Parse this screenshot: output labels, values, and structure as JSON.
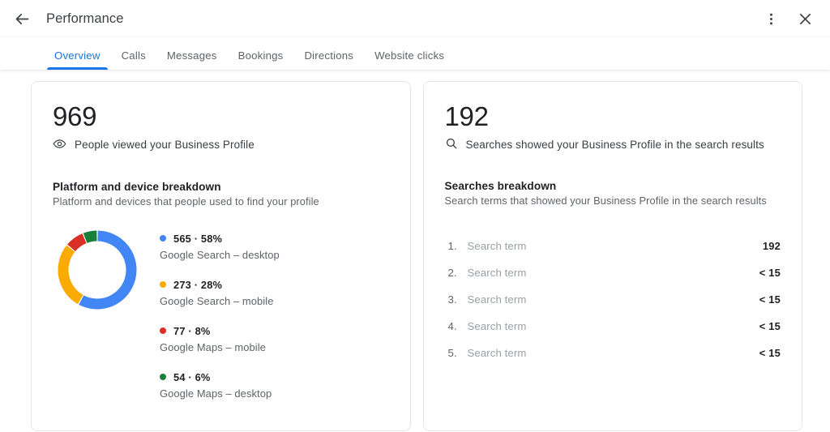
{
  "header": {
    "title": "Performance",
    "back_icon": "arrow-back-icon",
    "more_icon": "more-vert-icon",
    "close_icon": "close-icon"
  },
  "tabs": [
    {
      "label": "Overview",
      "active": true
    },
    {
      "label": "Calls",
      "active": false
    },
    {
      "label": "Messages",
      "active": false
    },
    {
      "label": "Bookings",
      "active": false
    },
    {
      "label": "Directions",
      "active": false
    },
    {
      "label": "Website clicks",
      "active": false
    }
  ],
  "colors": {
    "accent": "#1a73e8",
    "blue": "#4285f4",
    "yellow": "#f9ab00",
    "red": "#d93025",
    "green": "#188038",
    "text_primary": "#202124",
    "text_secondary": "#5f6368",
    "text_muted": "#9aa0a6"
  },
  "left_card": {
    "value": "969",
    "metric_label": "People viewed your Business Profile",
    "metric_icon": "eye-icon",
    "section_title": "Platform and device breakdown",
    "section_desc": "Platform and devices that people used to find your profile"
  },
  "right_card": {
    "value": "192",
    "metric_label": "Searches showed your Business Profile in the search results",
    "metric_icon": "search-icon",
    "section_title": "Searches breakdown",
    "section_desc": "Search terms that showed your Business Profile in the search results",
    "terms": [
      {
        "rank": "1.",
        "name": "Search term",
        "count": "192"
      },
      {
        "rank": "2.",
        "name": "Search term",
        "count": "< 15"
      },
      {
        "rank": "3.",
        "name": "Search term",
        "count": "< 15"
      },
      {
        "rank": "4.",
        "name": "Search term",
        "count": "< 15"
      },
      {
        "rank": "5.",
        "name": "Search term",
        "count": "< 15"
      }
    ]
  },
  "chart_data": {
    "type": "pie",
    "title": "Platform and device breakdown",
    "subtitle": "Platform and devices that people used to find your profile",
    "total": 969,
    "legend_position": "right",
    "categories": [
      "Google Search – desktop",
      "Google Search – mobile",
      "Google Maps – mobile",
      "Google Maps – desktop"
    ],
    "values": [
      565,
      273,
      77,
      54
    ],
    "percents": [
      58,
      28,
      8,
      6
    ],
    "colors": [
      "#4285f4",
      "#f9ab00",
      "#d93025",
      "#188038"
    ],
    "value_labels": [
      "565 · 58%",
      "273 · 28%",
      "77 · 8%",
      "54 · 6%"
    ],
    "slices": [
      {
        "label": "Google Search – desktop",
        "value": 565,
        "percent": 58,
        "color": "#4285f4",
        "display": "565 · 58%"
      },
      {
        "label": "Google Search – mobile",
        "value": 273,
        "percent": 28,
        "color": "#f9ab00",
        "display": "273 · 28%"
      },
      {
        "label": "Google Maps – mobile",
        "value": 77,
        "percent": 8,
        "color": "#d93025",
        "display": "77 · 8%"
      },
      {
        "label": "Google Maps – desktop",
        "value": 54,
        "percent": 6,
        "color": "#188038",
        "display": "54 · 6%"
      }
    ]
  }
}
